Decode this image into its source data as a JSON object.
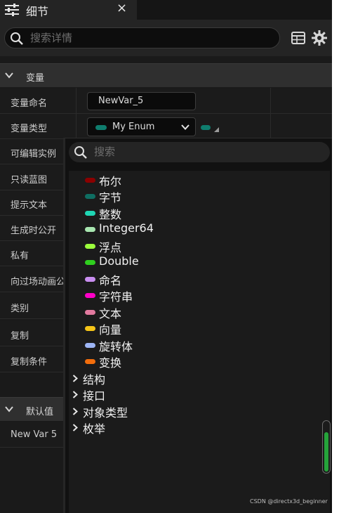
{
  "tab": {
    "title": "细节",
    "close": "×"
  },
  "search": {
    "placeholder": "搜索详情"
  },
  "sections": {
    "variable": "变量",
    "default": "默认值"
  },
  "rows": [
    "变量命名",
    "变量类型",
    "可编辑实例",
    "只读蓝图",
    "提示文本",
    "生成时公开",
    "私有",
    "向过场动画公开",
    "类别",
    "复制",
    "复制条件"
  ],
  "name_value": "NewVar_5",
  "type_value": "My Enum",
  "default_row": "New Var 5",
  "popup": {
    "placeholder": "搜索",
    "types": [
      {
        "label": "布尔",
        "color": "#8b0000"
      },
      {
        "label": "字节",
        "color": "#0f6e62"
      },
      {
        "label": "整数",
        "color": "#1fd6b4"
      },
      {
        "label": "Integer64",
        "color": "#a8e6b0"
      },
      {
        "label": "浮点",
        "color": "#9cff3c"
      },
      {
        "label": "Double",
        "color": "#2fcf1e"
      },
      {
        "label": "命名",
        "color": "#c98ef0"
      },
      {
        "label": "字符串",
        "color": "#ff00c8"
      },
      {
        "label": "文本",
        "color": "#e27a9f"
      },
      {
        "label": "向量",
        "color": "#f5c518"
      },
      {
        "label": "旋转体",
        "color": "#9db5f5"
      },
      {
        "label": "变换",
        "color": "#f26d0c"
      }
    ],
    "categories": [
      "结构",
      "接口",
      "对象类型",
      "枚举"
    ]
  },
  "watermark": "CSDN @directx3d_beginner",
  "colors": {
    "accent_green": "#25a33a",
    "byte_teal": "#0f7d6e"
  }
}
